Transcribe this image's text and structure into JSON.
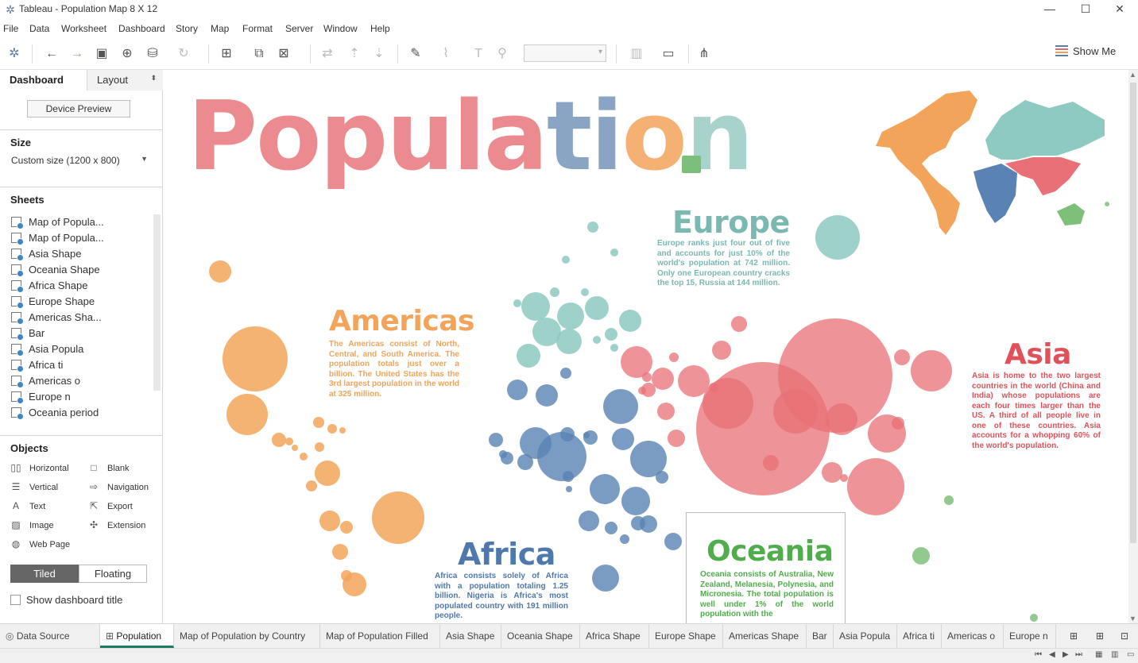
{
  "window": {
    "title": "Tableau - Population Map 8 X 12",
    "minimize": "—",
    "maximize": "☐",
    "close": "✕"
  },
  "menu": [
    "File",
    "Data",
    "Worksheet",
    "Dashboard",
    "Story",
    "Map",
    "Format",
    "Server",
    "Window",
    "Help"
  ],
  "toolbar": {
    "show_me": "Show Me"
  },
  "left_panel": {
    "tab_dashboard": "Dashboard",
    "tab_layout": "Layout",
    "device_preview": "Device Preview",
    "size_title": "Size",
    "size_value": "Custom size (1200 x 800)",
    "sheets_title": "Sheets",
    "sheets": [
      "Map of Popula...",
      "Map of Popula...",
      "Asia Shape",
      "Oceania Shape",
      "Africa Shape",
      "Europe Shape",
      "Americas Sha...",
      "Bar",
      "Asia Popula",
      "Africa ti",
      "Americas o",
      "Europe n",
      "Oceania period"
    ],
    "objects_title": "Objects",
    "objects": [
      {
        "label": "Horizontal",
        "icon": "horizontal-icon"
      },
      {
        "label": "Blank",
        "icon": "blank-icon"
      },
      {
        "label": "Vertical",
        "icon": "vertical-icon"
      },
      {
        "label": "Navigation",
        "icon": "navigation-icon"
      },
      {
        "label": "Text",
        "icon": "text-icon"
      },
      {
        "label": "Export",
        "icon": "export-icon"
      },
      {
        "label": "Image",
        "icon": "image-icon"
      },
      {
        "label": "Extension",
        "icon": "extension-icon"
      },
      {
        "label": "Web Page",
        "icon": "web-page-icon"
      }
    ],
    "tiled": "Tiled",
    "floating": "Floating",
    "show_title": "Show dashboard title"
  },
  "dashboard": {
    "title_letters": [
      {
        "ch": "P",
        "color": "#ec8b8f"
      },
      {
        "ch": "o",
        "color": "#ec8b8f"
      },
      {
        "ch": "p",
        "color": "#ec8b8f"
      },
      {
        "ch": "u",
        "color": "#ec8b8f"
      },
      {
        "ch": "l",
        "color": "#ec8b8f"
      },
      {
        "ch": "a",
        "color": "#ec8b8f"
      },
      {
        "ch": "t",
        "color": "#8aa5c4"
      },
      {
        "ch": "i",
        "color": "#8aa5c4"
      },
      {
        "ch": "o",
        "color": "#f4b173"
      },
      {
        "ch": "n",
        "color": "#a8d3cd"
      }
    ],
    "colors": {
      "americas": "#f2a45a",
      "europe": "#8ec9c2",
      "asia": "#e87076",
      "africa": "#5a83b3",
      "oceania": "#7ebf7a"
    },
    "americas": {
      "title": "Americas",
      "text": "The Americas consist of North, Central, and South America. The population totals just over a billion. The United States has the 3rd largest population in the world at 325 million."
    },
    "europe": {
      "title": "Europe",
      "text": "Europe ranks just four out of five and accounts for just 10% of the world's population at 742 million. Only one European country cracks the top 15, Russia at 144 million."
    },
    "asia": {
      "title": "Asia",
      "text": "Asia is home to the two largest countries in the world (China and India) whose populations are each four times larger than the US. A third of all people live in one of these countries. Asia accounts for a whopping 60% of the world's population."
    },
    "africa": {
      "title": "Africa",
      "text": "Africa consists solely of Africa with a population totaling 1.25 billion. Nigeria is Africa's most populated country with 191 million people."
    },
    "oceania": {
      "title": "Oceania",
      "text": "Oceania consists of Australia, New Zealand, Melanesia, Polynesia, and Micronesia. The total population is well under 1% of the world population with the"
    }
  },
  "bottom_tabs": [
    "Data Source",
    "Population",
    "Map of Population by Country",
    "Map of Population Filled",
    "Asia Shape",
    "Oceania Shape",
    "Africa Shape",
    "Europe Shape",
    "Americas Shape",
    "Bar",
    "Asia Popula",
    "Africa ti",
    "Americas o",
    "Europe n"
  ]
}
